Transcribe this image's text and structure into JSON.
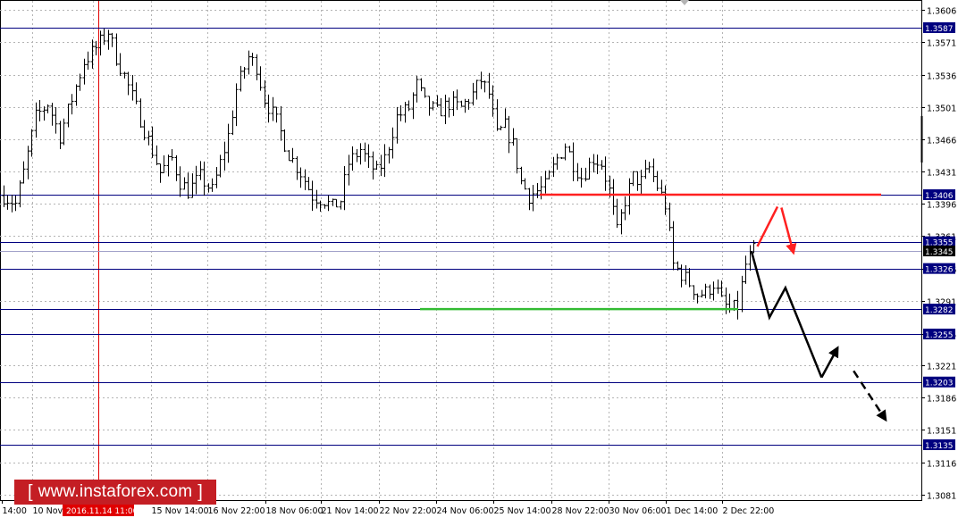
{
  "chart_data": {
    "type": "candlestick",
    "title": "",
    "timeframe_note": "hourly bars",
    "x_ticks": [
      "14:00",
      "10 Nov",
      "2016.11.14 11:00",
      "15 Nov 14:00",
      "16 Nov 22:00",
      "18 Nov 06:00",
      "21 Nov 14:00",
      "22 Nov 22:00",
      "24 Nov 06:00",
      "25 Nov 14:00",
      "28 Nov 22:00",
      "30 Nov 06:00",
      "1 Dec 14:00",
      "2 Dec 22:00"
    ],
    "y_ticks": [
      "1.3606",
      "1.3571",
      "1.3536",
      "1.3501",
      "1.3466",
      "1.3431",
      "1.3396",
      "1.3361",
      "1.3326",
      "1.3291",
      "1.3255",
      "1.3221",
      "1.3186",
      "1.3151",
      "1.3116",
      "1.3081"
    ],
    "ylim": [
      1.3075,
      1.3616
    ],
    "grid": true,
    "price_levels": [
      {
        "value": 1.3587,
        "label": "1.3587",
        "color": "#00007f"
      },
      {
        "value": 1.3406,
        "label": "1.3406",
        "color": "#00007f"
      },
      {
        "value": 1.3355,
        "label": "1.3355",
        "color": "#00007f"
      },
      {
        "value": 1.3326,
        "label": "1.3326",
        "color": "#00007f"
      },
      {
        "value": 1.3282,
        "label": "1.3282",
        "color": "#00007f"
      },
      {
        "value": 1.3255,
        "label": "1.3255",
        "color": "#00007f"
      },
      {
        "value": 1.3203,
        "label": "1.3203",
        "color": "#00007f"
      },
      {
        "value": 1.3135,
        "label": "1.3135",
        "color": "#00007f"
      }
    ],
    "current_price": {
      "value": 1.3345,
      "label": "1.3345",
      "color": "#000000"
    },
    "highlight_time": {
      "label": "2016.11.14 11:00",
      "color": "#e00000"
    },
    "key_levels": [
      {
        "name": "resistance",
        "value": 1.3406,
        "color": "#ff2020"
      },
      {
        "name": "support",
        "value": 1.3282,
        "color": "#33bb33"
      }
    ],
    "price_path": [
      [
        0,
        1.3405
      ],
      [
        3,
        1.3396
      ],
      [
        5,
        1.343
      ],
      [
        8,
        1.349
      ],
      [
        11,
        1.3505
      ],
      [
        14,
        1.347
      ],
      [
        17,
        1.351
      ],
      [
        20,
        1.355
      ],
      [
        23,
        1.3565
      ],
      [
        26,
        1.3583
      ],
      [
        28,
        1.3555
      ],
      [
        30,
        1.3535
      ],
      [
        33,
        1.35
      ],
      [
        36,
        1.3465
      ],
      [
        39,
        1.343
      ],
      [
        42,
        1.3445
      ],
      [
        44,
        1.342
      ],
      [
        46,
        1.341
      ],
      [
        49,
        1.3425
      ],
      [
        52,
        1.341
      ],
      [
        54,
        1.344
      ],
      [
        56,
        1.347
      ],
      [
        58,
        1.352
      ],
      [
        61,
        1.3555
      ],
      [
        63,
        1.3545
      ],
      [
        65,
        1.351
      ],
      [
        68,
        1.3485
      ],
      [
        71,
        1.345
      ],
      [
        74,
        1.343
      ],
      [
        77,
        1.3405
      ],
      [
        80,
        1.34
      ],
      [
        82,
        1.3392
      ],
      [
        84,
        1.34
      ],
      [
        86,
        1.344
      ],
      [
        89,
        1.3455
      ],
      [
        91,
        1.344
      ],
      [
        93,
        1.343
      ],
      [
        95,
        1.3445
      ],
      [
        98,
        1.349
      ],
      [
        101,
        1.35
      ],
      [
        103,
        1.3525
      ],
      [
        105,
        1.3505
      ],
      [
        108,
        1.3495
      ],
      [
        111,
        1.3505
      ],
      [
        114,
        1.35
      ],
      [
        117,
        1.3515
      ],
      [
        119,
        1.353
      ],
      [
        121,
        1.3515
      ],
      [
        123,
        1.347
      ],
      [
        125,
        1.348
      ],
      [
        127,
        1.346
      ],
      [
        129,
        1.342
      ],
      [
        131,
        1.3405
      ],
      [
        133,
        1.341
      ],
      [
        135,
        1.3415
      ],
      [
        138,
        1.3445
      ],
      [
        140,
        1.346
      ],
      [
        142,
        1.344
      ],
      [
        144,
        1.3425
      ],
      [
        147,
        1.3445
      ],
      [
        149,
        1.344
      ],
      [
        151,
        1.341
      ],
      [
        153,
        1.3365
      ],
      [
        155,
        1.34
      ],
      [
        157,
        1.3425
      ],
      [
        159,
        1.342
      ],
      [
        161,
        1.3435
      ],
      [
        163,
        1.3415
      ],
      [
        165,
        1.3395
      ],
      [
        167,
        1.333
      ],
      [
        169,
        1.332
      ],
      [
        171,
        1.331
      ],
      [
        173,
        1.3298
      ],
      [
        175,
        1.33
      ],
      [
        177,
        1.331
      ],
      [
        179,
        1.329
      ],
      [
        181,
        1.328
      ],
      [
        183,
        1.3285
      ],
      [
        185,
        1.333
      ],
      [
        187,
        1.3345
      ]
    ],
    "forecast_paths": [
      {
        "name": "forecast-red",
        "color": "#ff2020",
        "dashed": false,
        "arrow": false,
        "points": [
          [
            188,
            1.335
          ],
          [
            193,
            1.3393
          ]
        ]
      },
      {
        "name": "forecast-red-arrow",
        "color": "#ff2020",
        "dashed": false,
        "arrow": true,
        "points": [
          [
            194,
            1.3392
          ],
          [
            197,
            1.3343
          ]
        ]
      },
      {
        "name": "forecast-main",
        "color": "#000000",
        "dashed": false,
        "arrow": false,
        "points": [
          [
            186.5,
            1.3345
          ],
          [
            191,
            1.3273
          ],
          [
            195,
            1.3305
          ],
          [
            204,
            1.3208
          ]
        ]
      },
      {
        "name": "forecast-bounce",
        "color": "#000000",
        "dashed": false,
        "arrow": true,
        "points": [
          [
            204,
            1.3208
          ],
          [
            208,
            1.324
          ]
        ]
      },
      {
        "name": "forecast-final",
        "color": "#000000",
        "dashed": true,
        "arrow": true,
        "points": [
          [
            212,
            1.3215
          ],
          [
            220,
            1.3162
          ]
        ]
      }
    ]
  },
  "watermark": {
    "left_bracket": "[",
    "text": "www.instaforex.com",
    "right_bracket": "]"
  }
}
